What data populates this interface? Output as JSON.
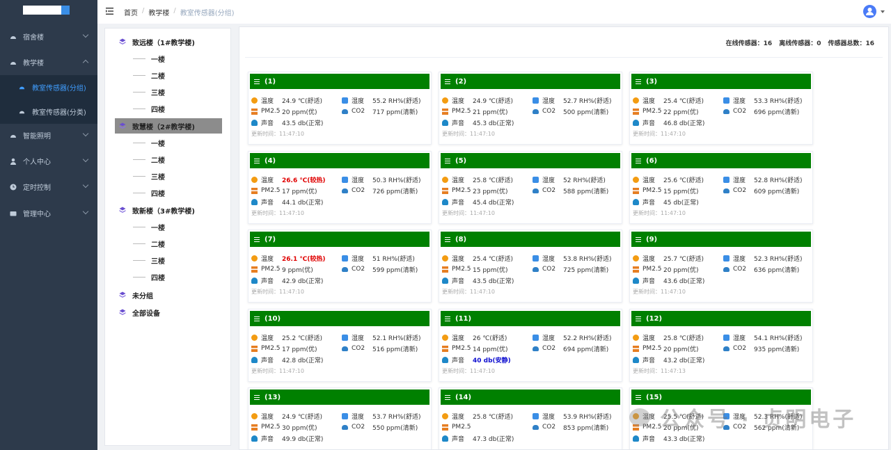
{
  "sidebar": {
    "items": [
      {
        "label": "宿舍楼",
        "expanded": false
      },
      {
        "label": "教学楼",
        "expanded": true
      },
      {
        "label": "智能照明",
        "expanded": false
      },
      {
        "label": "个人中心",
        "expanded": false
      },
      {
        "label": "定时控制",
        "expanded": false
      },
      {
        "label": "管理中心",
        "expanded": false
      }
    ],
    "sub_items": [
      {
        "label": "教室传感器(分组)",
        "active": true
      },
      {
        "label": "教室传感器(分类)",
        "active": false
      }
    ]
  },
  "header": {
    "breadcrumb": [
      "首页",
      "教学楼",
      "教室传感器(分组)"
    ]
  },
  "tree": {
    "buildings": [
      {
        "label": "致远楼（1#教学楼)",
        "floors": [
          "一楼",
          "二楼",
          "三楼",
          "四楼"
        ],
        "selected": false
      },
      {
        "label": "致慧楼（2#教学楼)",
        "floors": [
          "一楼",
          "二楼",
          "三楼",
          "四楼"
        ],
        "selected": true
      },
      {
        "label": "致新楼（3#教学楼)",
        "floors": [
          "一楼",
          "二楼",
          "三楼",
          "四楼"
        ],
        "selected": false
      }
    ],
    "extra": [
      "未分组",
      "全部设备"
    ]
  },
  "stats": {
    "online": "在线传感器：16",
    "offline": "离线传感器：0",
    "total": "传感器总数：16"
  },
  "labels": {
    "temp": "温度",
    "humid": "湿度",
    "pm": "PM2.5",
    "co2": "CO2",
    "sound": "声音",
    "updated_prefix": "更新时间："
  },
  "colors": {
    "card_header": "#008000",
    "warn": "#e00000",
    "quiet": "#1010d0",
    "active_menu": "#409eff"
  },
  "cards": [
    {
      "title": "(1)",
      "temp": "24.9 ℃(舒适)",
      "humid": "55.2 RH%(舒适)",
      "pm": "20 ppm(优)",
      "co2": "717 ppm(清新)",
      "sound": "43.5 db(正常)",
      "time": "更新时间：11:47:10"
    },
    {
      "title": "(2)",
      "temp": "24.9 ℃(舒适)",
      "humid": "52.7 RH%(舒适)",
      "pm": "21 ppm(优)",
      "co2": "500 ppm(清新)",
      "sound": "45.3 db(正常)",
      "time": "更新时间：11:47:10"
    },
    {
      "title": "(3)",
      "temp": "25.4 ℃(舒适)",
      "humid": "53.3 RH%(舒适)",
      "pm": "22 ppm(优)",
      "co2": "696 ppm(清新)",
      "sound": "46.8 db(正常)",
      "time": "更新时间：11:47:10"
    },
    {
      "title": "(4)",
      "temp": "26.6 ℃(较热)",
      "temp_warn": true,
      "humid": "50.3 RH%(舒适)",
      "pm": "17 ppm(优)",
      "co2": "726 ppm(清新)",
      "sound": "44.1 db(正常)",
      "time": "更新时间：11:47:10"
    },
    {
      "title": "(5)",
      "temp": "25.8 ℃(舒适)",
      "humid": "52 RH%(舒适)",
      "pm": "23 ppm(优)",
      "co2": "588 ppm(清新)",
      "sound": "45.4 db(正常)",
      "time": "更新时间：11:47:10"
    },
    {
      "title": "(6)",
      "temp": "25.6 ℃(舒适)",
      "humid": "52.8 RH%(舒适)",
      "pm": "15 ppm(优)",
      "co2": "609 ppm(清新)",
      "sound": "45 db(正常)",
      "time": "更新时间：11:47:10"
    },
    {
      "title": "(7)",
      "temp": "26.1 ℃(较热)",
      "temp_warn": true,
      "humid": "51 RH%(舒适)",
      "pm": "9 ppm(优)",
      "co2": "599 ppm(清新)",
      "sound": "42.9 db(正常)",
      "time": "更新时间：11:47:10"
    },
    {
      "title": "(8)",
      "temp": "25.4 ℃(舒适)",
      "humid": "53.8 RH%(舒适)",
      "pm": "15 ppm(优)",
      "co2": "725 ppm(清新)",
      "sound": "43.5 db(正常)",
      "time": "更新时间：11:47:10"
    },
    {
      "title": "(9)",
      "temp": "25.7 ℃(舒适)",
      "humid": "52.3 RH%(舒适)",
      "pm": "20 ppm(优)",
      "co2": "636 ppm(清新)",
      "sound": "43.6 db(正常)",
      "time": "更新时间：11:47:10"
    },
    {
      "title": "(10)",
      "temp": "25.2 ℃(舒适)",
      "humid": "52.1 RH%(舒适)",
      "pm": "17 ppm(优)",
      "co2": "516 ppm(清新)",
      "sound": "42.8 db(正常)",
      "time": "更新时间：11:47:10"
    },
    {
      "title": "(11)",
      "temp": "26 ℃(舒适)",
      "humid": "52.2 RH%(舒适)",
      "pm": "14 ppm(优)",
      "co2": "694 ppm(清新)",
      "sound": "40 db(安静)",
      "sound_quiet": true,
      "time": "更新时间：11:47:10"
    },
    {
      "title": "(12)",
      "temp": "25.8 ℃(舒适)",
      "humid": "54.1 RH%(舒适)",
      "pm": "20 ppm(优)",
      "co2": "935 ppm(清新)",
      "sound": "43.2 db(正常)",
      "time": "更新时间：11:47:13"
    },
    {
      "title": "(13)",
      "temp": "24.9 ℃(舒适)",
      "humid": "53.7 RH%(舒适)",
      "pm": "30 ppm(优)",
      "co2": "550 ppm(清新)",
      "sound": "49.9 db(正常)",
      "time": ""
    },
    {
      "title": "(14)",
      "temp": "25.8 ℃(舒适)",
      "humid": "53.9 RH%(舒适)",
      "pm": "",
      "co2": "853 ppm(清新)",
      "sound": "47.3 db(正常)",
      "time": ""
    },
    {
      "title": "(15)",
      "temp": "25.5 ℃(舒适)",
      "humid": "52.3 RH%(舒适)",
      "pm": "20 ppm(优)",
      "co2": "562 ppm(清新)",
      "sound": "43.3 db(正常)",
      "time": ""
    }
  ],
  "watermark": "公众号 · 贞明电子"
}
